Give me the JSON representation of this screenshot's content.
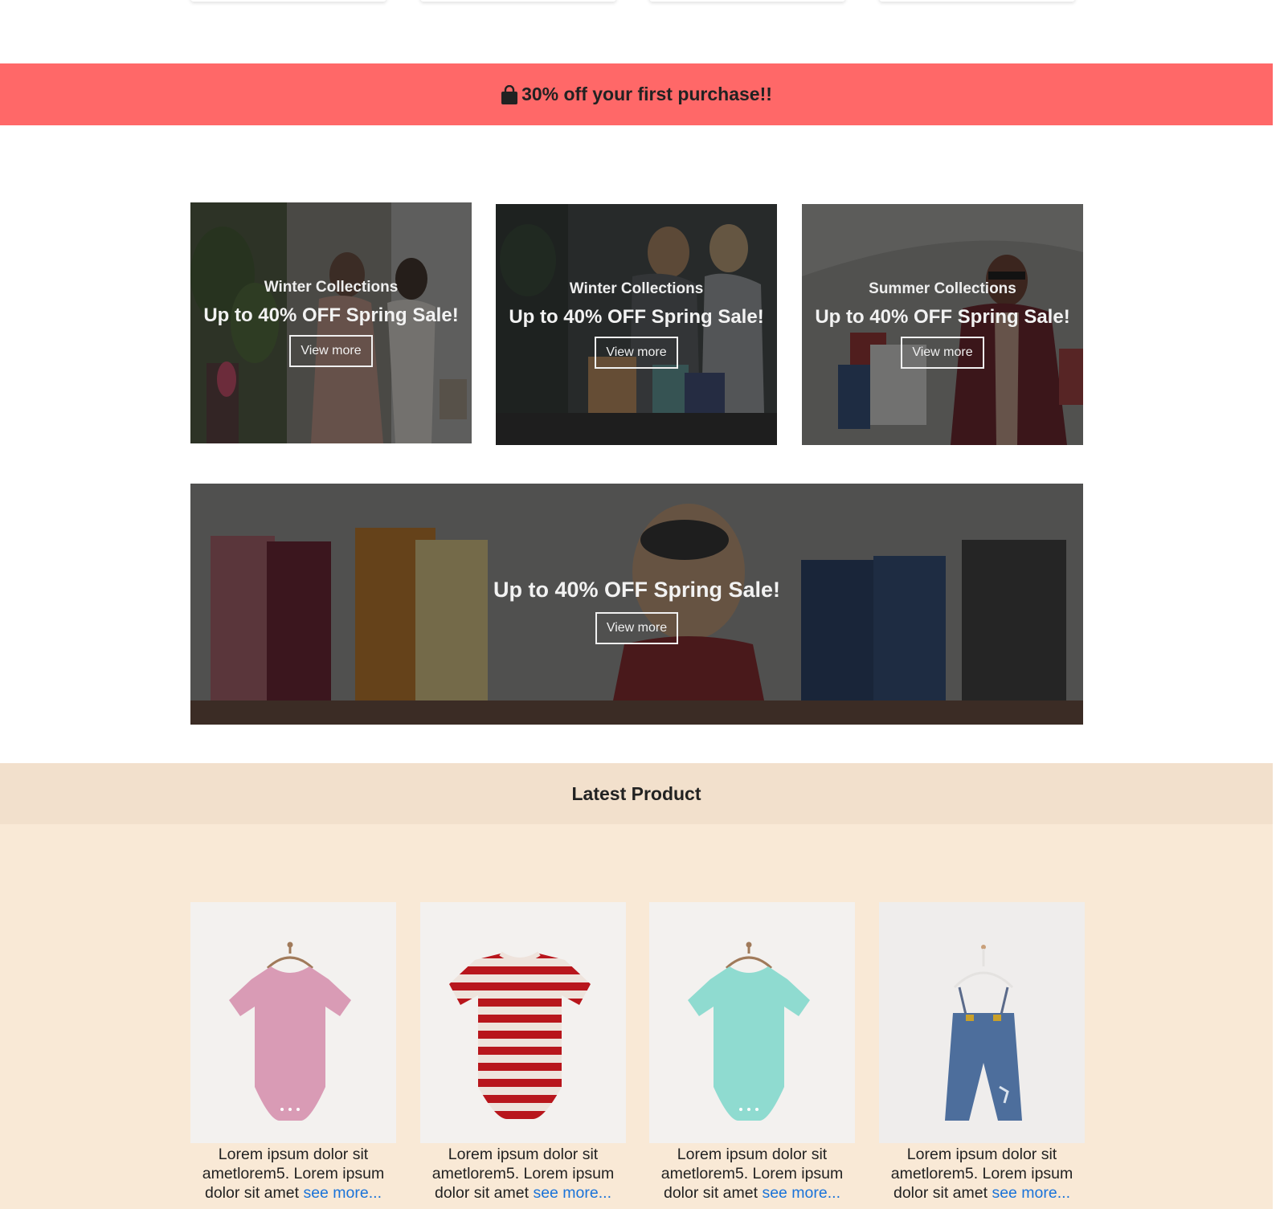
{
  "promo": {
    "text": "30% off your first purchase!!",
    "icon": "shopping-bag-icon"
  },
  "banners": [
    {
      "subtitle": "Winter Collections",
      "title": "Up to 40% OFF Spring Sale!",
      "button": "View more"
    },
    {
      "subtitle": "Winter Collections",
      "title": "Up to 40% OFF Spring Sale!",
      "button": "View more"
    },
    {
      "subtitle": "Summer Collections",
      "title": "Up to 40% OFF Spring Sale!",
      "button": "View more"
    }
  ],
  "wide_banner": {
    "title": "Up to 40% OFF Spring Sale!",
    "button": "View more"
  },
  "latest": {
    "heading": "Latest Product",
    "products": [
      {
        "text": "Lorem ipsum dolor sit ametlorem5. Lorem ipsum dolor sit amet ",
        "link": "see more..."
      },
      {
        "text": "Lorem ipsum dolor sit ametlorem5. Lorem ipsum dolor sit amet ",
        "link": "see more..."
      },
      {
        "text": "Lorem ipsum dolor sit ametlorem5. Lorem ipsum dolor sit amet ",
        "link": "see more..."
      },
      {
        "text": "Lorem ipsum dolor sit ametlorem5. Lorem ipsum dolor sit amet ",
        "link": "see more..."
      }
    ]
  },
  "colors": {
    "promo_bg": "#ff6868",
    "latest_head_bg": "#f2e0cc",
    "latest_bg": "#f9e9d6",
    "link": "#1a73d9"
  }
}
